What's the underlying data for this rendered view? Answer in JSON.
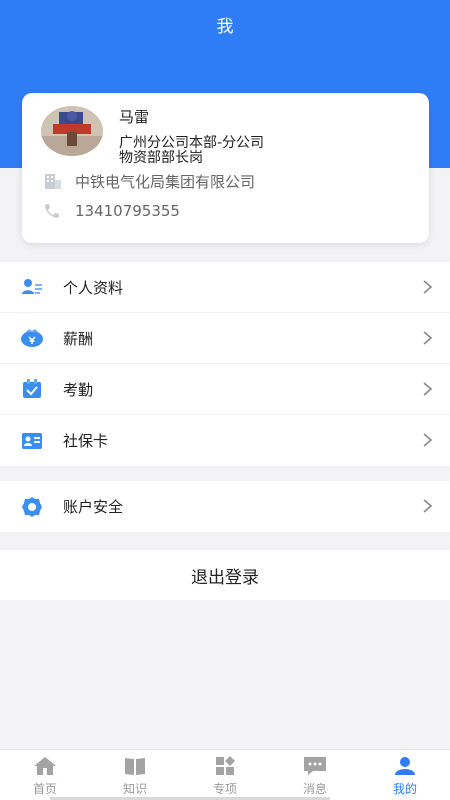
{
  "header": {
    "title": "我"
  },
  "profile": {
    "name": "马雷",
    "dept_line1": "广州分公司本部-分公司",
    "dept_line2": "物资部部长岗",
    "company": "中铁电气化局集团有限公司",
    "phone": "13410795355"
  },
  "menu": {
    "items": [
      {
        "label": "个人资料",
        "icon": "profile-icon"
      },
      {
        "label": "薪酬",
        "icon": "salary-icon"
      },
      {
        "label": "考勤",
        "icon": "attendance-icon"
      },
      {
        "label": "社保卡",
        "icon": "social-security-card-icon"
      }
    ],
    "security": {
      "label": "账户安全",
      "icon": "security-gear-icon"
    }
  },
  "logout": {
    "label": "退出登录"
  },
  "tabbar": {
    "tabs": [
      {
        "label": "首页",
        "icon": "home-icon"
      },
      {
        "label": "知识",
        "icon": "book-icon"
      },
      {
        "label": "专项",
        "icon": "grid-icon"
      },
      {
        "label": "消息",
        "icon": "message-icon"
      },
      {
        "label": "我的",
        "icon": "user-icon",
        "active": true
      }
    ]
  },
  "colors": {
    "primary": "#2f7df6",
    "background": "#f3f3f5"
  }
}
